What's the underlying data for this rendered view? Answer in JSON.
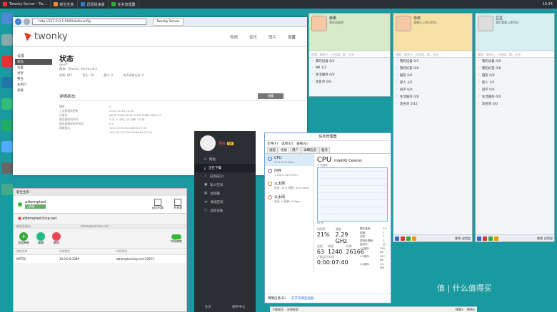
{
  "taskbar": {
    "tabs": [
      "Twonky Server - Tw…",
      "新生生表",
      "迅雷极速版",
      "任务管理器"
    ],
    "clock": "19:34"
  },
  "browser": {
    "url": "http://127.0.0.1:9000/webconfig",
    "tab_title": "Twonky Server"
  },
  "twonky": {
    "logo": "twonky",
    "nav": [
      "视频",
      "音乐",
      "图片",
      "设置"
    ],
    "sidebar": [
      "设置",
      "状态",
      "设置",
      "共享",
      "整合",
      "多用户",
      "高级"
    ],
    "title": "状态",
    "subtitle": "geoff",
    "version": "版本: Twonky Server 8.2",
    "counts": [
      {
        "k": "视频:",
        "v": "947"
      },
      {
        "k": "音乐:",
        "v": "18"
      },
      {
        "k": "图片:",
        "v": "0"
      },
      {
        "k": "有声读物记录:",
        "v": "0"
      }
    ],
    "detail_title": "详细状态:",
    "detail_btn": "隐藏",
    "rows": [
      {
        "k": "播放",
        "v": "0"
      },
      {
        "k": "上次数据库更新",
        "v": "2015-12-20 15:20"
      },
      {
        "k": "注册码",
        "v": "MBTK-FXR8-XK9S-XLFM-PM8B-XKGC-TL"
      },
      {
        "k": "服务器联机时间",
        "v": "0 天, 0 小时, 40 分钟, 19 秒"
      },
      {
        "k": "服务器播放程序地址",
        "v": "0:0"
      },
      {
        "k": "网络接口",
        "v": "10.0.0.9   04:64:A8:9A:75:54"
      },
      {
        "k": "",
        "v": "10.0.34.190   00:09:6A:09:22:A4"
      }
    ]
  },
  "qq_panels": [
    {
      "name": "荣果",
      "sig": "我在逗留吧",
      "search": "搜索：联系人，讨论组，群，企业",
      "groups": [
        "我的设备 0/1",
        "NB 1/3",
        "生活服务 0/0",
        "黑名单 0/0"
      ]
    },
    {
      "name": "依依",
      "sig": "我曾正上的小的生…",
      "search": "搜索：联系人，讨论组，群，企业",
      "groups": [
        "我的设备 0/1",
        "我的好友 0/0",
        "朋友 0/0",
        "家人 2/5",
        "同学 0/0",
        "生活服务 0/0",
        "黑名单 0/12"
      ]
    },
    {
      "name": "豆豆",
      "sig": "我们我要上就不好…",
      "search": "搜索：联系人，讨论组，群，企业",
      "groups": [
        "我的设备 0/0",
        "我的好友 0/6",
        "朋友 0/0",
        "家人 1/5",
        "同学 0/0",
        "生活服务 0/0",
        "黑名单 0/0"
      ]
    }
  ],
  "qq_bar": {
    "label1": "查找",
    "label2": "应用宝"
  },
  "netdisk": {
    "user": "网名",
    "level": "V6",
    "menu": [
      "网站",
      "正在下载",
      "已完成(2)",
      "私人空间",
      "垃圾箱",
      "离线空间",
      "远程设备"
    ],
    "footer": [
      "主页",
      "服务中心"
    ]
  },
  "taskmgr": {
    "title": "任务管理器",
    "menu": [
      "文件(F)",
      "选项(O)",
      "查看(V)"
    ],
    "tabs": [
      "进程",
      "性能",
      "用户",
      "详细信息",
      "服务"
    ],
    "resources": [
      {
        "name": "CPU",
        "sub": "21%  2.29 GHz",
        "color": "#2f7ad6"
      },
      {
        "name": "内存",
        "sub": "1.5/8.0 GB (19%)",
        "color": "#9b3fb8"
      },
      {
        "name": "以太网",
        "sub": "发送: 32.0 接收: 16.0 Kbps",
        "color": "#c87d2a"
      },
      {
        "name": "以太网",
        "sub": "发送: 0 接收: 0 Kbps",
        "color": "#c87d2a"
      }
    ],
    "cpu_title": "CPU",
    "cpu_name": "Intel(R) Celeron",
    "graph_label": "% 利用率",
    "graph_time": "60 秒",
    "stats": [
      {
        "l": "利用率",
        "v": "21%"
      },
      {
        "l": "速度",
        "v": "2.29 GHz"
      },
      {
        "l": "进程",
        "v": "63"
      },
      {
        "l": "线程",
        "v": "1240"
      },
      {
        "l": "句柄",
        "v": "26166"
      },
      {
        "l": "正常运行时间",
        "v": "0:00:07:40"
      }
    ],
    "specs": [
      {
        "k": "基准速度:",
        "v": "2.4"
      },
      {
        "k": "插槽:",
        "v": "1"
      },
      {
        "k": "内核:",
        "v": "2"
      },
      {
        "k": "逻辑处理器:",
        "v": "2"
      },
      {
        "k": "虚拟化:",
        "v": "已…"
      },
      {
        "k": "L1 缓存:",
        "v": "128 KB"
      },
      {
        "k": "L2 缓存:",
        "v": "512 KB"
      },
      {
        "k": "L3 缓存:",
        "v": "2.0 MB"
      }
    ],
    "footer": [
      "简略信息(D)",
      "打开资源监视器"
    ]
  },
  "vpn": {
    "title": "新生生表",
    "profile": "attempted",
    "status": "已连接",
    "btn1": "成功列表",
    "btn2": "共享表",
    "host": "attempted.hicp.net",
    "tbl_title": "新生生表名",
    "actions": [
      "添加映射",
      "编辑",
      "删除"
    ],
    "toggle": "内网映射",
    "cols": [
      "映射名称",
      "本地地址",
      "外网地址"
    ],
    "row": [
      "MSTSC",
      "10.0.0.9:3389",
      "attempted.hicp.net:33553"
    ]
  },
  "bottom": {
    "items": [
      "下载成功",
      "计划任务",
      "0KB/s",
      "0KB/s"
    ]
  },
  "watermark": "值 | 什么值得买"
}
